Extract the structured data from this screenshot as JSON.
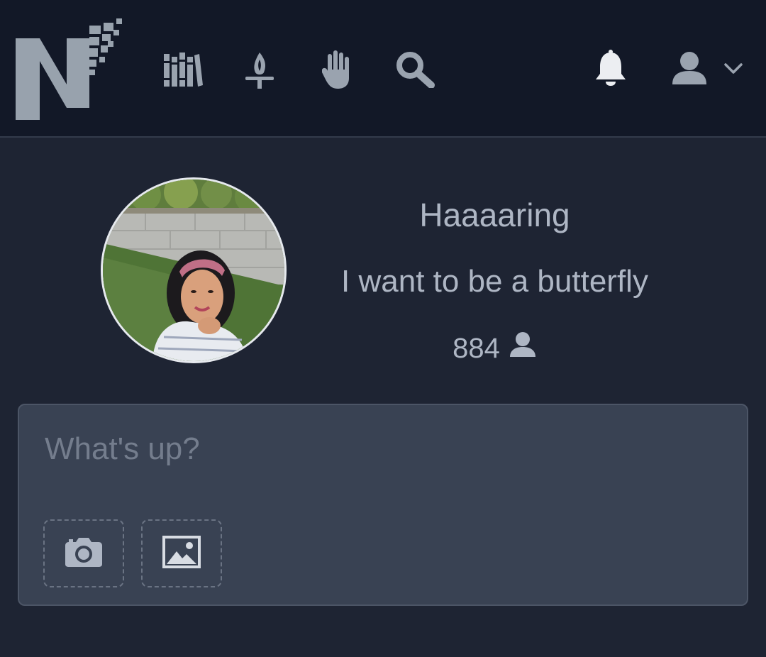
{
  "nav": {
    "logo": "logo-icon",
    "items": [
      {
        "icon": "library-icon"
      },
      {
        "icon": "torch-icon"
      },
      {
        "icon": "hand-icon"
      },
      {
        "icon": "search-icon"
      }
    ],
    "notifications_icon": "bell-icon",
    "account_icon": "user-icon",
    "account_menu_icon": "chevron-down-icon"
  },
  "profile": {
    "name": "Haaaaring",
    "bio": "I want to be a butterfly",
    "followers_count": "884",
    "followers_icon": "user-icon"
  },
  "composer": {
    "placeholder": "What's up?",
    "value": "",
    "buttons": [
      {
        "icon": "camera-icon"
      },
      {
        "icon": "image-icon"
      }
    ]
  },
  "colors": {
    "topbar": "#121827",
    "background": "#1e2433",
    "composer": "#394253",
    "text": "#aeb6c4",
    "placeholder": "#747d8d",
    "icons": "#9aa3af"
  }
}
